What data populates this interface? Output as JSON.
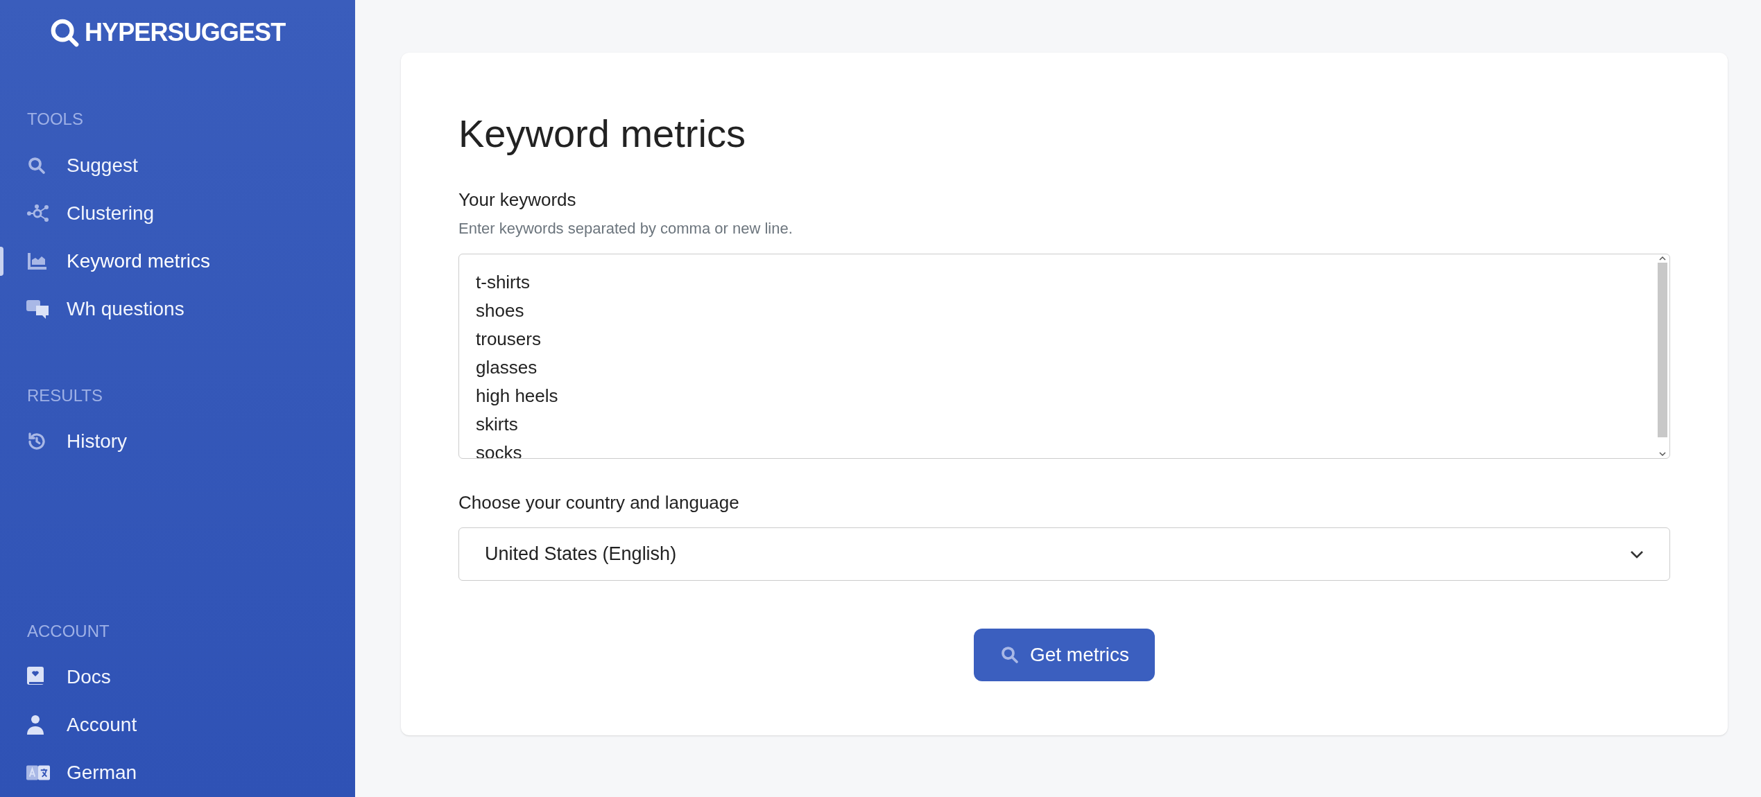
{
  "logo": {
    "text": "HYPERSUGGEST"
  },
  "sidebar": {
    "sections": [
      {
        "title": "TOOLS",
        "items": [
          {
            "label": "Suggest",
            "selected": false
          },
          {
            "label": "Clustering",
            "selected": false
          },
          {
            "label": "Keyword metrics",
            "selected": true
          },
          {
            "label": "Wh questions",
            "selected": false
          }
        ]
      },
      {
        "title": "RESULTS",
        "items": [
          {
            "label": "History",
            "selected": false
          }
        ]
      },
      {
        "title": "ACCOUNT",
        "items": [
          {
            "label": "Docs",
            "selected": false
          },
          {
            "label": "Account",
            "selected": false
          },
          {
            "label": "German",
            "selected": false
          }
        ]
      }
    ]
  },
  "page": {
    "title": "Keyword metrics",
    "keywords": {
      "label": "Your keywords",
      "hint": "Enter keywords separated by comma or new line.",
      "lines": [
        "t-shirts",
        "shoes",
        "trousers",
        "glasses",
        "high heels",
        "skirts",
        "socks"
      ]
    },
    "country": {
      "label": "Choose your country and language",
      "value": "United States (English)"
    },
    "button": {
      "label": "Get metrics"
    }
  }
}
